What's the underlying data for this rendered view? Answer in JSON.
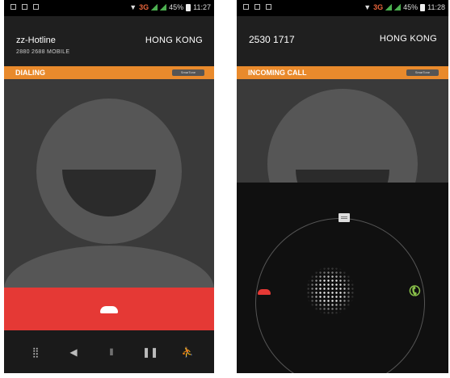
{
  "left_screen": {
    "status": {
      "network": "3G",
      "battery": "45%",
      "time": "11:27"
    },
    "caller_name": "zz-Hotline",
    "caller_number": "2880 2688 MOBILE",
    "location": "HONG KONG",
    "call_state": "DIALING",
    "badge": "SmarTone",
    "controls": [
      "dialpad-icon",
      "speaker-icon",
      "mute-icon",
      "hold-icon",
      "add-call-icon"
    ]
  },
  "right_screen": {
    "status": {
      "network": "3G",
      "battery": "45%",
      "time": "11:28"
    },
    "caller_number": "2530 1717",
    "location": "HONG KONG",
    "call_state": "INCOMING CALL",
    "badge": "SmarTone"
  },
  "colors": {
    "accent_orange": "#e98a2c",
    "end_call_red": "#e53935",
    "answer_green": "#8bc34a",
    "network_orange": "#e8643a"
  }
}
